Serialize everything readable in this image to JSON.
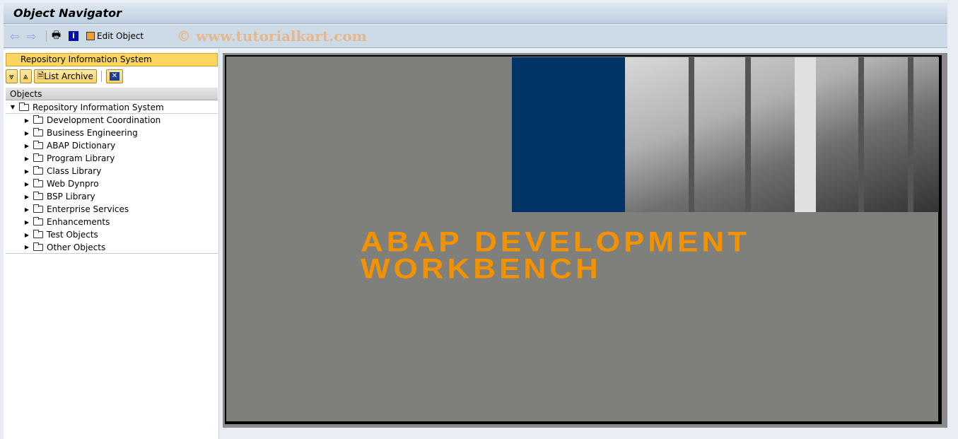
{
  "window": {
    "title": "Object Navigator"
  },
  "toolbar": {
    "back": "back",
    "forward": "forward",
    "edit_object": "Edit Object",
    "watermark": "© www.tutorialkart.com"
  },
  "left_panel": {
    "selector": "Repository Information System",
    "buttons": {
      "list_archive": "List Archive"
    },
    "header": "Objects",
    "root": "Repository Information System",
    "items": [
      "Development Coordination",
      "Business Engineering",
      "ABAP Dictionary",
      "Program Library",
      "Class Library",
      "Web Dynpro",
      "BSP Library",
      "Enterprise Services",
      "Enhancements",
      "Test Objects",
      "Other Objects"
    ]
  },
  "splash": {
    "line1": "ABAP DEVELOPMENT",
    "line2": "WORKBENCH",
    "text_color": "#f39200",
    "block_color": "#003366"
  }
}
